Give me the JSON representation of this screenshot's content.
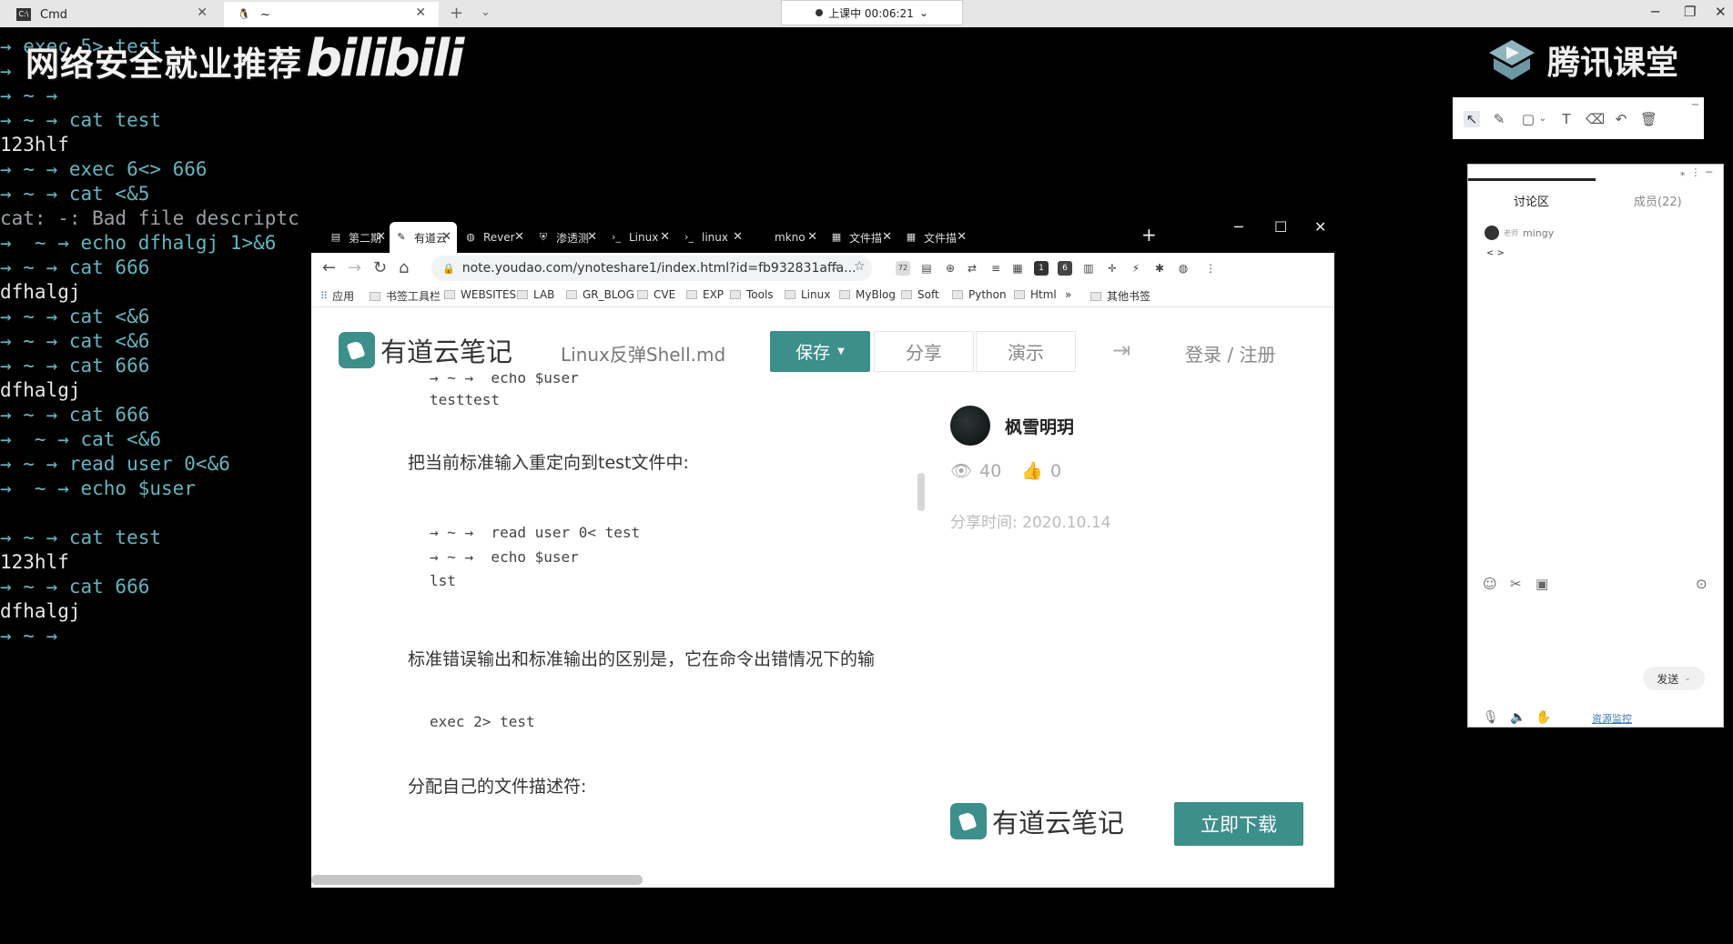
{
  "wt": {
    "tab_cmd": "Cmd",
    "tab_shell": "~",
    "live_status": "上课中 00:06:21"
  },
  "terminal": {
    "watermark": "网络安全就业推荐",
    "bili_logo": "bilibili",
    "lines": [
      {
        "t": "→ exec 5> test",
        "k": "p"
      },
      {
        "t": "→",
        "k": "p"
      },
      {
        "t": "→ ~ →",
        "k": "p"
      },
      {
        "t": "→ ~ → cat test",
        "k": "p"
      },
      {
        "t": "123hlf",
        "k": "o"
      },
      {
        "t": "→ ~ → exec 6<> 666",
        "k": "p"
      },
      {
        "t": "→ ~ → cat <&5",
        "k": "p"
      },
      {
        "t": "cat: -: Bad file descriptc",
        "k": "e"
      },
      {
        "t": "→  ~ → echo dfhalgj 1>&6",
        "k": "p"
      },
      {
        "t": "→ ~ → cat 666",
        "k": "p"
      },
      {
        "t": "dfhalgj",
        "k": "o"
      },
      {
        "t": "→ ~ → cat <&6",
        "k": "p"
      },
      {
        "t": "→ ~ → cat <&6",
        "k": "p"
      },
      {
        "t": "→ ~ → cat 666",
        "k": "p"
      },
      {
        "t": "dfhalgj",
        "k": "o"
      },
      {
        "t": "→ ~ → cat 666",
        "k": "p"
      },
      {
        "t": "→  ~ → cat <&6",
        "k": "p"
      },
      {
        "t": "→ ~ → read user 0<&6",
        "k": "p"
      },
      {
        "t": "→  ~ → echo $user",
        "k": "p"
      },
      {
        "t": "",
        "k": "o"
      },
      {
        "t": "→ ~ → cat test",
        "k": "p"
      },
      {
        "t": "123hlf",
        "k": "o"
      },
      {
        "t": "→ ~ → cat 666",
        "k": "p"
      },
      {
        "t": "dfhalgj",
        "k": "o"
      },
      {
        "t": "→ ~ →",
        "k": "p"
      }
    ]
  },
  "tencent": {
    "logo_text": "腾讯课堂",
    "discuss_tab": "讨论区",
    "members_tab": "成员(22)",
    "msg_role": "老师",
    "msg_user": "mingy",
    "msg_body": "< >",
    "send_label": "发送",
    "resource_link": "资源监控"
  },
  "chrome": {
    "tabs": [
      {
        "label": "第二期",
        "icon": "file-icon"
      },
      {
        "label": "有道云",
        "icon": "youdao-icon"
      },
      {
        "label": "Rever",
        "icon": "globe-icon"
      },
      {
        "label": "渗透测",
        "icon": "shield-icon"
      },
      {
        "label": "Linux",
        "icon": "terminal-icon"
      },
      {
        "label": "linux",
        "icon": "terminal-icon"
      },
      {
        "label": "mkno",
        "icon": "blank-icon"
      },
      {
        "label": "文件描",
        "icon": "doc-icon"
      },
      {
        "label": "文件描",
        "icon": "doc-icon"
      }
    ],
    "url": "note.youdao.com/ynoteshare1/index.html?id=fb932831affa...",
    "bookmarks": [
      "应用",
      "书签工具栏",
      "WEBSITES",
      "LAB",
      "GR_BLOG",
      "CVE",
      "EXP",
      "Tools",
      "Linux",
      "MyBlog",
      "Soft",
      "Python",
      "Html",
      "»",
      "其他书签"
    ],
    "ext_badges": {
      "count72": "72",
      "count1": "1",
      "count6": "6"
    }
  },
  "youdao": {
    "logo_text": "有道云笔记",
    "doc_title": "Linux反弹Shell.md",
    "save_label": "保存",
    "share_label": "分享",
    "present_label": "演示",
    "login_label": "登录 / 注册",
    "code1_l1": "→ ~ →  echo $user",
    "code1_l2": "testtest",
    "para1": "把当前标准输入重定向到test文件中:",
    "code2_l1": "→ ~ →  read user 0< test",
    "code2_l2": "→ ~ →  echo $user",
    "code2_l3": "lst",
    "para2": "标准错误输出和标准输出的区别是，它在命令出错情况下的输",
    "code3": "exec 2> test",
    "para3": "分配自己的文件描述符:",
    "author": "枫雪明玥",
    "views": "40",
    "likes": "0",
    "share_time": "分享时间: 2020.10.14",
    "download_label": "立即下载"
  }
}
